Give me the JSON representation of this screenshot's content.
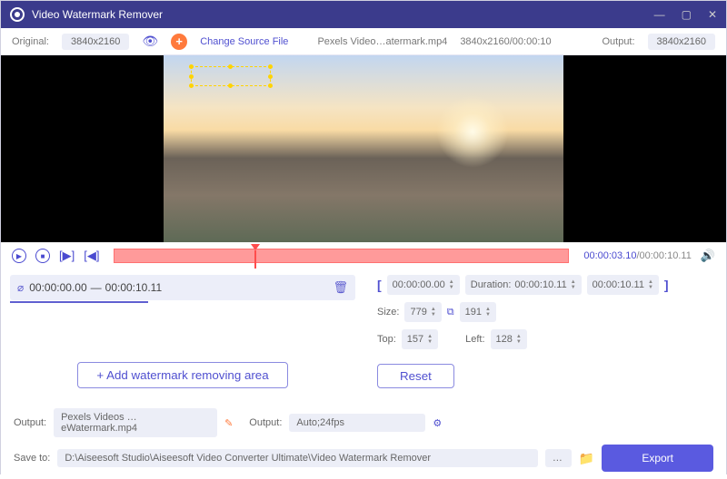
{
  "titlebar": {
    "title": "Video Watermark Remover"
  },
  "topbar": {
    "original_label": "Original:",
    "original_res": "3840x2160",
    "change_source": "Change Source File",
    "filename": "Pexels Video…atermark.mp4",
    "file_meta": "3840x2160/00:00:10",
    "output_label": "Output:",
    "output_res": "3840x2160"
  },
  "timeline": {
    "current": "00:00:03.10",
    "total": "00:00:10.11"
  },
  "segment": {
    "start": "00:00:00.00",
    "sep": "—",
    "end": "00:00:10.11"
  },
  "add_area": "Add watermark removing area",
  "range": {
    "start": "00:00:00.00",
    "duration_label": "Duration:",
    "duration": "00:00:10.11",
    "end": "00:00:10.11"
  },
  "size": {
    "label": "Size:",
    "w": "779",
    "h": "191"
  },
  "pos": {
    "top_label": "Top:",
    "top": "157",
    "left_label": "Left:",
    "left": "128"
  },
  "reset": "Reset",
  "output": {
    "label1": "Output:",
    "filename": "Pexels Videos …eWatermark.mp4",
    "label2": "Output:",
    "format": "Auto;24fps"
  },
  "save": {
    "label": "Save to:",
    "path": "D:\\Aiseesoft Studio\\Aiseesoft Video Converter Ultimate\\Video Watermark Remover"
  },
  "export": "Export"
}
